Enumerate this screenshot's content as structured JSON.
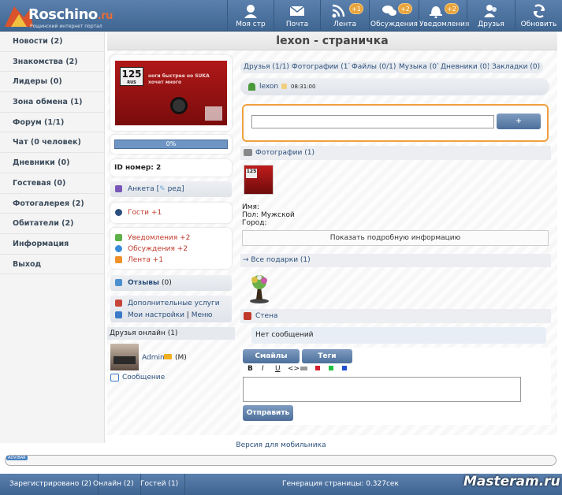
{
  "header": {
    "logo_name": "Roschino",
    "logo_tld": ".ru",
    "logo_sub": "Рощинский интернет портал",
    "nav": [
      {
        "label": "Моя стр",
        "icon": "user-icon",
        "badge": ""
      },
      {
        "label": "Почта",
        "icon": "mail-icon",
        "badge": ""
      },
      {
        "label": "Лента",
        "icon": "rss-icon",
        "badge": "+1"
      },
      {
        "label": "Обсуждения",
        "icon": "chat-icon",
        "badge": "+2"
      },
      {
        "label": "Уведомления",
        "icon": "bell-icon",
        "badge": "+2"
      },
      {
        "label": "Друзья",
        "icon": "friends-icon",
        "badge": ""
      },
      {
        "label": "Обновить",
        "icon": "refresh-icon",
        "badge": ""
      }
    ]
  },
  "sidebar": {
    "items": [
      "Новости (2)",
      "Знакомства (2)",
      "Лидеры (0)",
      "Зона обмена (1)",
      "Форум (1/1)",
      "Чат (0 человек)",
      "Дневники (0)",
      "Гостевая (0)",
      "Фотогалерея (2)",
      "Обитатели (2)",
      "Информация",
      "Выход"
    ]
  },
  "page": {
    "title": "lexon - страничка"
  },
  "profile": {
    "plate_number": "125",
    "plate_region": "RUS",
    "photo_caption": "ноги быстрее но SUKA хочет много",
    "progress": "0%",
    "progress_value": 0,
    "id_label": "ID номер: 2",
    "anketa": "Анкета",
    "anketa_edit": "ред",
    "guests_label": "Гости",
    "guests_badge": "+1",
    "notifications": "Уведомления +2",
    "discussions": "Обсуждения +2",
    "feed": "Лента +1",
    "reviews_label": "Отзывы",
    "reviews_count": "(0)",
    "extra_services": "Дополнительные услуги",
    "my_settings": "Мои настройки",
    "menu": "Меню",
    "friends_online_title": "Друзья онлайн (1)",
    "friend_name": "Admin",
    "friend_gender": "(M)",
    "message": "Сообщение"
  },
  "tabs": [
    "Друзья (1/1)",
    "Фотографии (1)",
    "Файлы (0/1)",
    "Музыка (0)",
    "Дневники (0)",
    "Закладки (0)"
  ],
  "status": {
    "user": "lexon",
    "time": "08:31:00",
    "post_button": "+"
  },
  "photos": {
    "title": "Фотографии (1)",
    "thumb_plate": "125"
  },
  "info": {
    "name_label": "Имя:",
    "gender_label": "Пол:",
    "gender_value": "Мужской",
    "city_label": "Город:",
    "show_more": "Показать подробную информацию"
  },
  "gifts": {
    "title": "→ Все подарки (1)"
  },
  "wall": {
    "title": "Стена",
    "empty": "Нет сообщений",
    "smileys_button": "Смайлы",
    "tags_button": "Теги",
    "format": [
      "B",
      "I",
      "U"
    ],
    "send_button": "Отправить"
  },
  "footer": {
    "mobile_link": "Версия для мобильника",
    "tiny_label": "ADV/BAR",
    "registered": "Зарегистрировано (2)",
    "online": "Онлайн (2)",
    "guests": "Гостей (1)",
    "generation": "Генерация страницы: 0.327сек",
    "watermark": "Masteram.ru"
  },
  "colors": {
    "accent": "#4a6f9a",
    "orange": "#f0a040",
    "red": "#c0392b"
  }
}
